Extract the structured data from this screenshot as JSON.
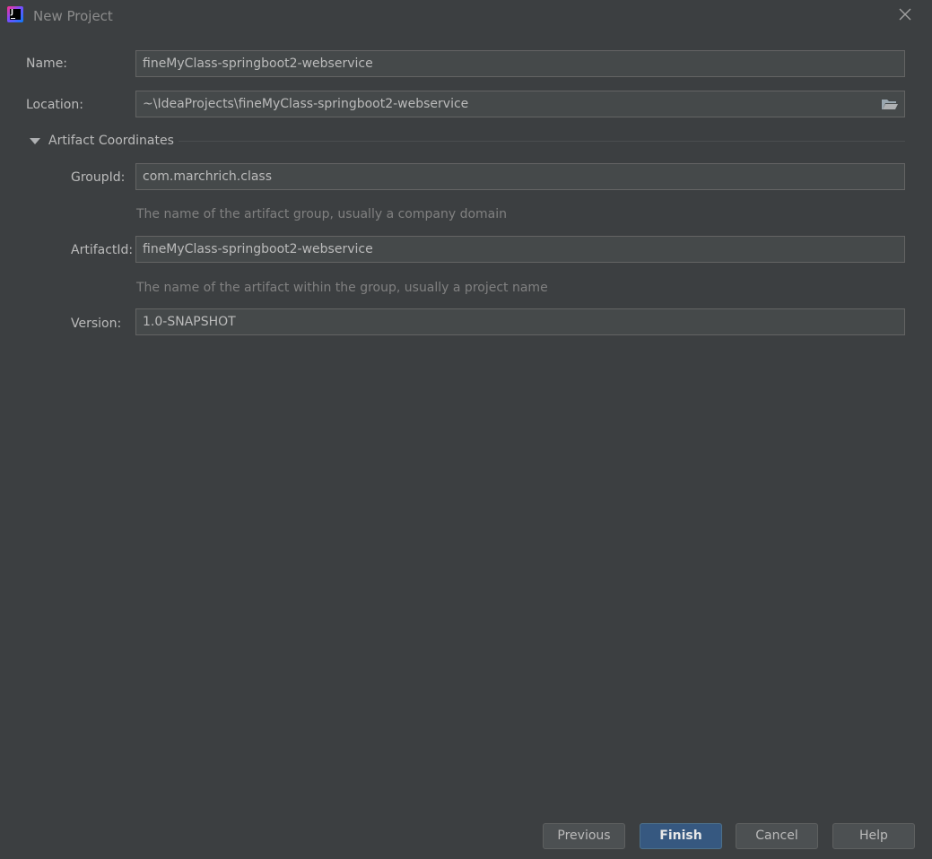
{
  "window": {
    "title": "New Project"
  },
  "form": {
    "name": {
      "label": "Name:",
      "value": "fineMyClass-springboot2-webservice"
    },
    "location": {
      "label": "Location:",
      "value": "~\\IdeaProjects\\fineMyClass-springboot2-webservice",
      "browse_icon": "folder-open-icon"
    }
  },
  "artifact_coordinates": {
    "title": "Artifact Coordinates",
    "expanded": true,
    "group_id": {
      "label": "GroupId:",
      "value": "com.marchrich.class",
      "hint": "The name of the artifact group, usually a company domain"
    },
    "artifact_id": {
      "label": "ArtifactId:",
      "value": "fineMyClass-springboot2-webservice",
      "hint": "The name of the artifact within the group, usually a project name"
    },
    "version": {
      "label": "Version:",
      "value": "1.0-SNAPSHOT"
    }
  },
  "buttons": {
    "previous": "Previous",
    "finish": "Finish",
    "cancel": "Cancel",
    "help": "Help"
  },
  "colors": {
    "background": "#3c3f41",
    "field_background": "#45494a",
    "field_border": "#646464",
    "text": "#bbbbbb",
    "hint_text": "#808080",
    "primary_button": "#365880"
  }
}
